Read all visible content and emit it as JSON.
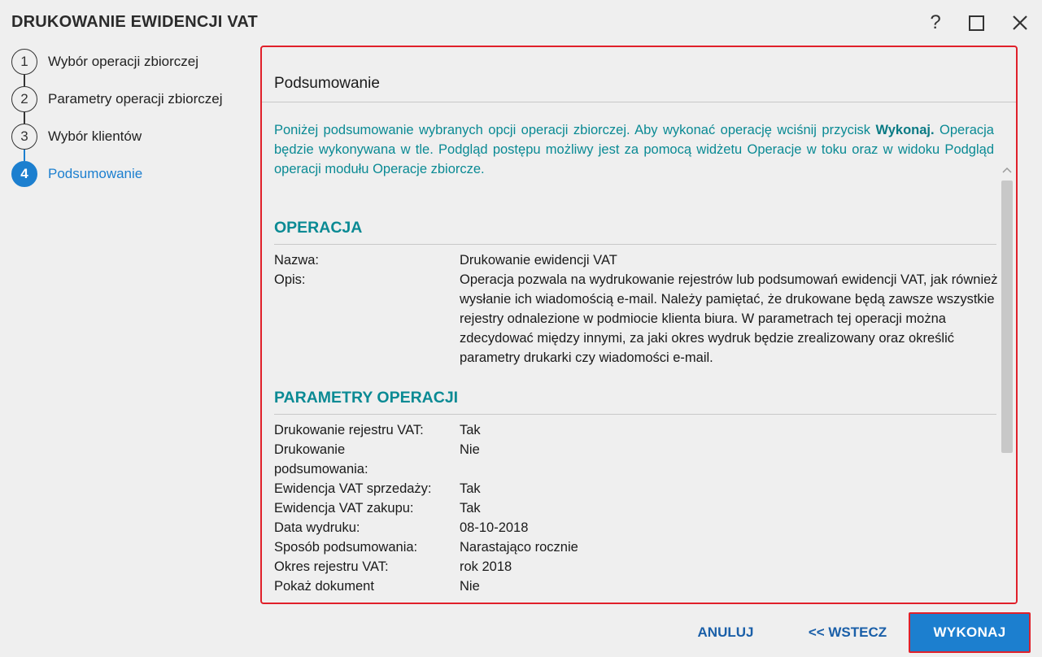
{
  "window": {
    "title": "DRUKOWANIE EWIDENCJI VAT",
    "help_glyph": "?",
    "icons": [
      "help-icon",
      "maximize-icon",
      "close-icon"
    ]
  },
  "steps": [
    {
      "num": "1",
      "label": "Wybór operacji zbiorczej",
      "state": "done"
    },
    {
      "num": "2",
      "label": "Parametry operacji zbiorczej",
      "state": "done"
    },
    {
      "num": "3",
      "label": "Wybór klientów",
      "state": "done"
    },
    {
      "num": "4",
      "label": "Podsumowanie",
      "state": "active"
    }
  ],
  "summary": {
    "title": "Podsumowanie",
    "intro_before": "Poniżej podsumowanie wybranych opcji operacji zbiorczej. Aby wykonać operację wciśnij przycisk ",
    "intro_bold": "Wykonaj.",
    "intro_after": " Operacja będzie wykonywana w tle. Podgląd postępu możliwy jest za pomocą widżetu Operacje w toku oraz w widoku Podgląd operacji modułu Operacje zbiorcze."
  },
  "operation": {
    "heading": "OPERACJA",
    "rows": [
      {
        "key": "Nazwa:",
        "value": "Drukowanie ewidencji VAT"
      },
      {
        "key": "Opis:",
        "value": "Operacja pozwala na wydrukowanie rejestrów lub podsumowań ewidencji VAT, jak również wysłanie ich wiadomością e-mail. Należy pamiętać, że drukowane będą zawsze wszystkie rejestry odnalezione w podmiocie klienta biura. W parametrach tej operacji można zdecydować między innymi, za jaki okres wydruk będzie zrealizowany oraz określić parametry drukarki czy wiadomości e-mail."
      }
    ]
  },
  "parameters": {
    "heading": "PARAMETRY OPERACJI",
    "rows": [
      {
        "key": "Drukowanie rejestru VAT:",
        "value": "Tak"
      },
      {
        "key": "Drukowanie podsumowania:",
        "value": "Nie"
      },
      {
        "key": "Ewidencja VAT sprzedaży:",
        "value": "Tak"
      },
      {
        "key": "Ewidencja VAT zakupu:",
        "value": "Tak"
      },
      {
        "key": "Data wydruku:",
        "value": "08-10-2018"
      },
      {
        "key": "Sposób podsumowania:",
        "value": "Narastająco rocznie"
      },
      {
        "key": "Okres rejestru VAT:",
        "value": "rok 2018"
      },
      {
        "key": "Pokaż dokument",
        "value": "Nie"
      }
    ]
  },
  "footer": {
    "cancel_label": "ANULUJ",
    "back_label": "<< WSTECZ",
    "run_label": "WYKONAJ"
  },
  "colors": {
    "accent_blue": "#1c7fcf",
    "teal_text": "#0a8a94",
    "highlight_red": "#e0202a"
  }
}
